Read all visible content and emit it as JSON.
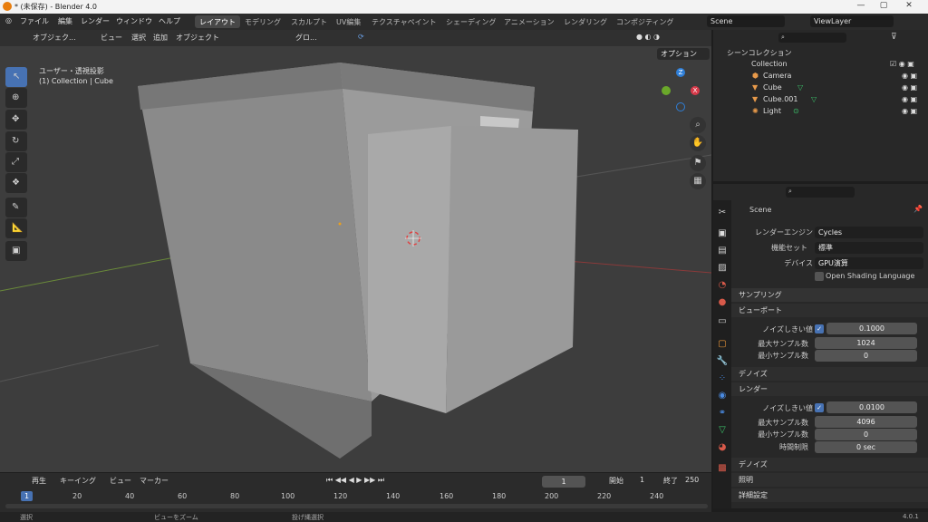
{
  "window": {
    "title": "* (未保存) - Blender 4.0"
  },
  "menus": [
    "ファイル",
    "編集",
    "レンダー",
    "ウィンドウ",
    "ヘルプ"
  ],
  "workspaces": [
    "レイアウト",
    "モデリング",
    "スカルプト",
    "UV編集",
    "テクスチャペイント",
    "シェーディング",
    "アニメーション",
    "レンダリング",
    "コンポジティング"
  ],
  "scene": {
    "name": "Scene",
    "view_layer": "ViewLayer"
  },
  "viewport_header": {
    "mode": "オブジェク...",
    "view": "ビュー",
    "select": "選択",
    "add": "追加",
    "object": "オブジェクト",
    "transform": "グロ...",
    "options": "オプション"
  },
  "viewport": {
    "perspective": "ユーザー・透視投影",
    "context": "(1) Collection | Cube"
  },
  "gizmo": {
    "z": "Z",
    "y": "Y",
    "x": "X"
  },
  "outliner": {
    "root": "シーンコレクション",
    "collection": "Collection",
    "items": [
      "Camera",
      "Cube",
      "Cube.001",
      "Light"
    ]
  },
  "properties": {
    "scene": "Scene",
    "render_engine_label": "レンダーエンジン",
    "render_engine": "Cycles",
    "feature_set_label": "機能セット",
    "feature_set": "標準",
    "device_label": "デバイス",
    "device": "GPU演算",
    "osl": "Open Shading Language",
    "sampling": "サンプリング",
    "viewport_section": "ビューポート",
    "noise_threshold_label": "ノイズしきい値",
    "vp_noise": "0.1000",
    "max_samples_label": "最大サンプル数",
    "vp_max": "1024",
    "min_samples_label": "最小サンプル数",
    "vp_min": "0",
    "denoise": "デノイズ",
    "render_section": "レンダー",
    "r_noise": "0.0100",
    "r_max": "4096",
    "r_min": "0",
    "time_limit_label": "時間制限",
    "time_limit": "0 sec",
    "lights": "照明",
    "advanced": "詳細設定"
  },
  "timeline": {
    "playback": "再生",
    "keying": "キーイング",
    "view": "ビュー",
    "marker": "マーカー",
    "current": "1",
    "start_label": "開始",
    "start": "1",
    "end_label": "終了",
    "end": "250",
    "frames": [
      "1",
      "20",
      "40",
      "60",
      "80",
      "100",
      "120",
      "140",
      "160",
      "180",
      "200",
      "220",
      "240"
    ]
  },
  "status": {
    "select": "選択",
    "zoom": "ビューをズーム",
    "lasso": "投げ縄選択",
    "version": "4.0.1"
  }
}
